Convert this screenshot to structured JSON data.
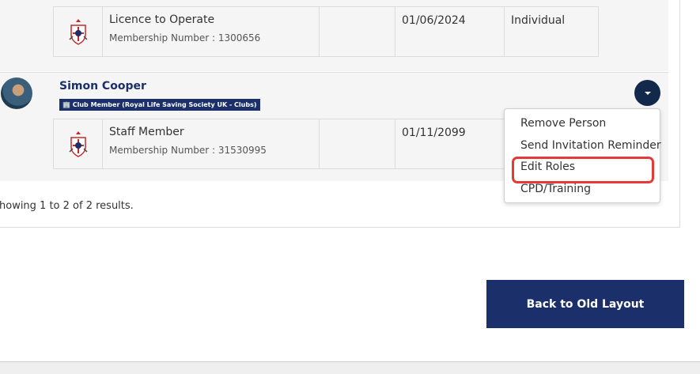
{
  "roles_top": {
    "title": "Licence to Operate",
    "membership": "Membership Number : 1300656",
    "date": "01/06/2024",
    "type": "Individual"
  },
  "person": {
    "name": "Simon Cooper",
    "badge": "🏢 Club Member (Royal Life Saving Society UK - Clubs)",
    "role": {
      "title": "Staff Member",
      "membership": "Membership Number : 31530995",
      "date": "01/11/2099"
    }
  },
  "menu": {
    "items": [
      "Remove Person",
      "Send Invitation Reminder",
      "Edit Roles",
      "CPD/Training"
    ],
    "highlight_color": "#e53935"
  },
  "results_text": "howing 1 to 2 of 2 results.",
  "back_button": "Back to Old Layout",
  "colors": {
    "navy": "#1b2f6b",
    "dark_caret": "#13294b",
    "row_bg": "#f5f5f5"
  }
}
